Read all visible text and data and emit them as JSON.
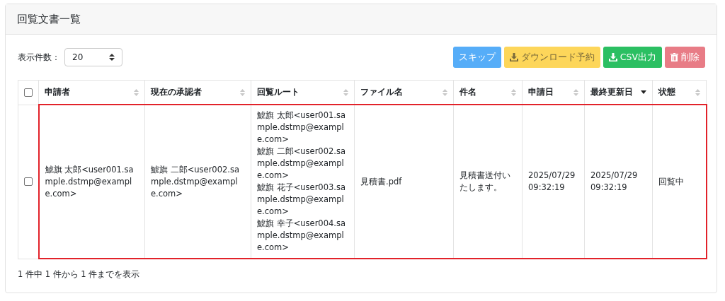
{
  "card": {
    "title": "回覧文書一覧"
  },
  "page_size": {
    "label": "表示件数：",
    "value": "20"
  },
  "buttons": [
    {
      "label": "スキップ",
      "kind": "skip",
      "disabled": false
    },
    {
      "label": "ダウンロード予約",
      "kind": "download",
      "disabled": false
    },
    {
      "label": "CSV出力",
      "kind": "csv",
      "disabled": false
    },
    {
      "label": "削除",
      "kind": "delete",
      "disabled": true
    }
  ],
  "table": {
    "select_all": {
      "checked": false
    },
    "columns": [
      {
        "label": "申請者",
        "sorted": false
      },
      {
        "label": "現在の承認者",
        "sorted": false
      },
      {
        "label": "回覧ルート",
        "sorted": false
      },
      {
        "label": "ファイル名",
        "sorted": false
      },
      {
        "label": "件名",
        "sorted": false
      },
      {
        "label": "申請日",
        "sorted": false
      },
      {
        "label": "最終更新日",
        "sorted": true
      },
      {
        "label": "状態",
        "sorted": false
      }
    ],
    "rows": [
      {
        "checked": false,
        "highlighted": true,
        "applicant": "鯱旗 太郎<user001.sample.dstmp@example.com>",
        "approver": "鯱旗 二郎<user002.sample.dstmp@example.com>",
        "route": [
          "鯱旗 太郎<user001.sample.dstmp@example.com>",
          "鯱旗 二郎<user002.sample.dstmp@example.com>",
          "鯱旗 花子<user003.sample.dstmp@example.com>",
          "鯱旗 幸子<user004.sample.dstmp@example.com>"
        ],
        "file": "見積書.pdf",
        "subject": "見積書送付いたします。",
        "applied": [
          "2025/07/29",
          "09:32:19"
        ],
        "updated": [
          "2025/07/29",
          "09:32:19"
        ],
        "status": "回覧中"
      }
    ]
  },
  "footer": "1 件中 1 件から 1 件までを表示"
}
